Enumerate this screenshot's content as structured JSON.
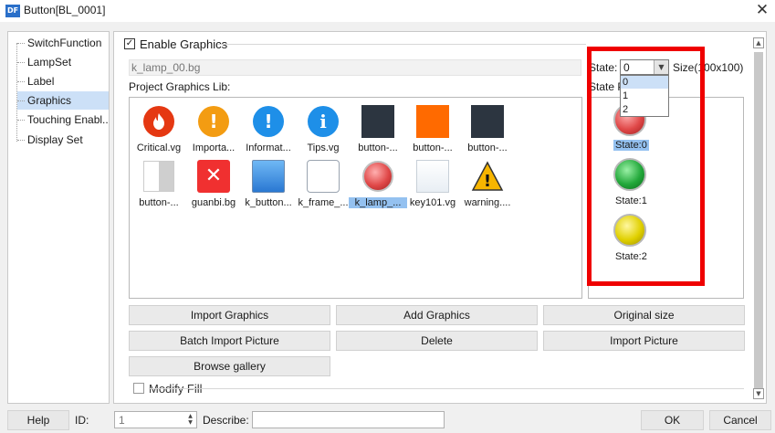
{
  "window": {
    "title": "Button[BL_0001]",
    "app_icon": "DF",
    "close_glyph": "✕"
  },
  "sidebar": {
    "items": [
      {
        "label": "SwitchFunction"
      },
      {
        "label": "LampSet"
      },
      {
        "label": "Label"
      },
      {
        "label": "Graphics",
        "selected": true
      },
      {
        "label": "Touching Enabl..."
      },
      {
        "label": "Display Set"
      }
    ]
  },
  "graphics": {
    "enable_label": "Enable Graphics",
    "enable_checked": true,
    "current_path": "k_lamp_00.bg",
    "lib_label": "Project Graphics Lib:",
    "library": [
      {
        "label": "Critical.vg",
        "icon": "flame-icon"
      },
      {
        "label": "Importa...",
        "icon": "exclamation-icon"
      },
      {
        "label": "Informat...",
        "icon": "exclamation-icon"
      },
      {
        "label": "Tips.vg",
        "icon": "info-icon"
      },
      {
        "label": "button-...",
        "icon": "dark-square-icon"
      },
      {
        "label": "button-...",
        "icon": "orange-square-icon"
      },
      {
        "label": "button-...",
        "icon": "dark-square-icon"
      },
      {
        "label": "button-...",
        "icon": "half-gray-square-icon"
      },
      {
        "label": "guanbi.bg",
        "icon": "close-square-icon"
      },
      {
        "label": "k_button...",
        "icon": "blue-gradient-square-icon"
      },
      {
        "label": "k_frame_...",
        "icon": "frame-icon"
      },
      {
        "label": "k_lamp_...",
        "icon": "red-lamp-icon",
        "selected": true
      },
      {
        "label": "key101.vg",
        "icon": "key-icon"
      },
      {
        "label": "warning....",
        "icon": "warning-triangle-icon"
      }
    ],
    "state_label": "State:",
    "state_value": "0",
    "state_options": [
      "0",
      "1",
      "2"
    ],
    "size_label": "Size(100x100)",
    "state_p_label": "State P",
    "states": [
      {
        "label": "State:0",
        "color": "#e04848",
        "selected": true
      },
      {
        "label": "State:1",
        "color": "#22a83a"
      },
      {
        "label": "State:2",
        "color": "#e0d000"
      }
    ],
    "buttons": {
      "import_graphics": "Import Graphics",
      "add_graphics": "Add Graphics",
      "original_size": "Original size",
      "batch_import": "Batch Import Picture",
      "delete": "Delete",
      "import_picture": "Import Picture",
      "browse_gallery": "Browse gallery"
    },
    "modify_fill_label": "Modify Fill",
    "modify_fill_checked": false
  },
  "footer": {
    "help": "Help",
    "id_label": "ID:",
    "id_value": "1",
    "describe_label": "Describe:",
    "describe_value": "",
    "ok": "OK",
    "cancel": "Cancel"
  },
  "colors": {
    "highlight_box": "#ef0000",
    "selection": "#cce0f7"
  }
}
